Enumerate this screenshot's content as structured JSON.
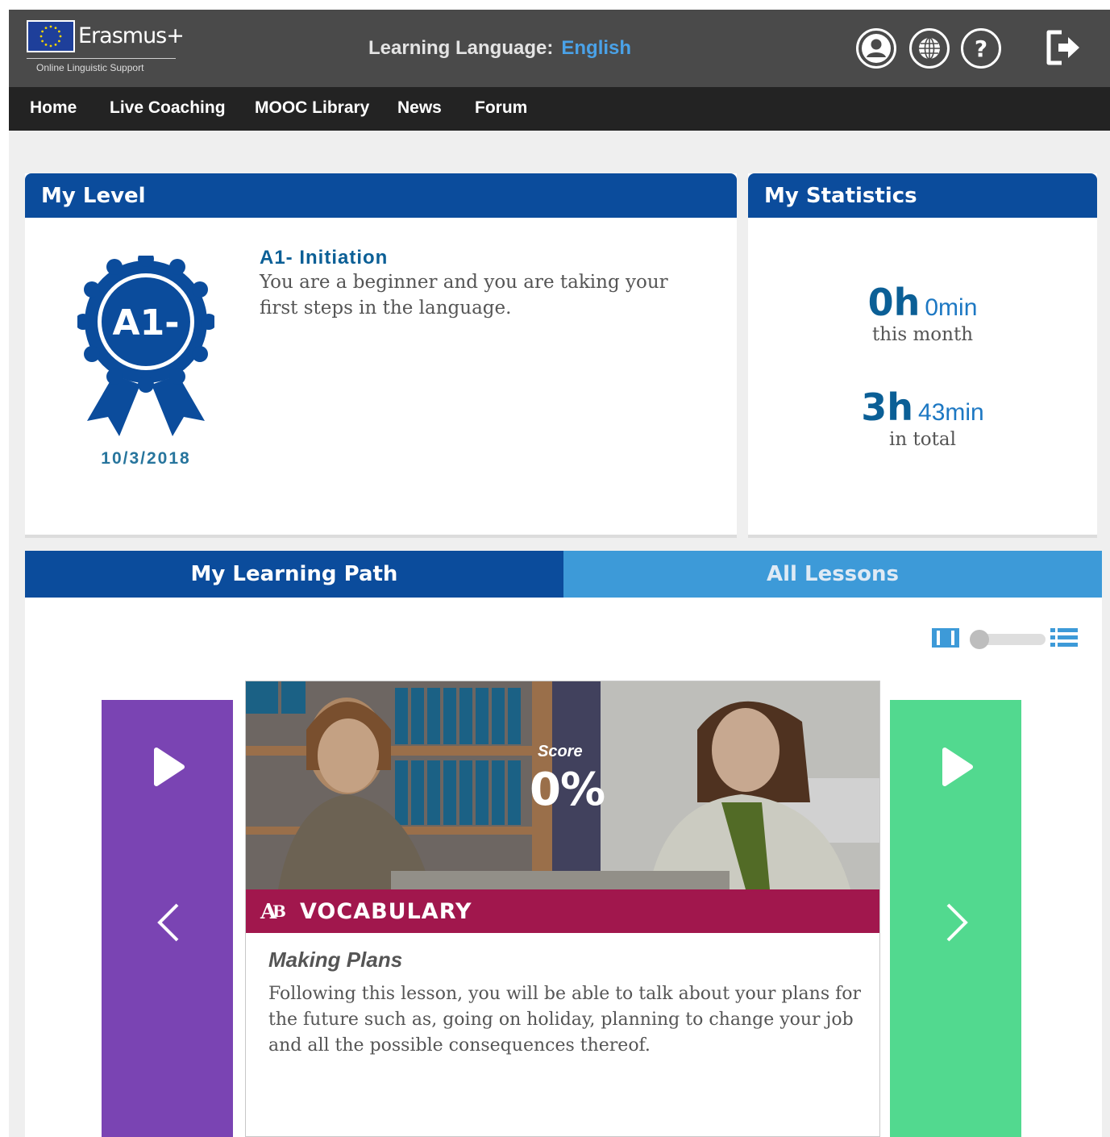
{
  "brand": {
    "name": "Erasmus+",
    "subtitle": "Online Linguistic Support"
  },
  "header": {
    "learning_language_label": "Learning Language:",
    "learning_language_value": "English",
    "icons": [
      "user-icon",
      "globe-icon",
      "help-icon",
      "logout-icon"
    ]
  },
  "nav": {
    "items": [
      {
        "label": "Home"
      },
      {
        "label": "Live Coaching"
      },
      {
        "label": "MOOC Library"
      },
      {
        "label": "News"
      },
      {
        "label": "Forum"
      }
    ]
  },
  "my_level": {
    "title": "My Level",
    "badge": "A1-",
    "date": "10/3/2018",
    "level_name": "A1- Initiation",
    "description": "You are a beginner and you are taking your first steps in the language."
  },
  "my_statistics": {
    "title": "My Statistics",
    "month": {
      "hours": "0h",
      "minutes": "0min",
      "label": "this month"
    },
    "total": {
      "hours": "3h",
      "minutes": "43min",
      "label": "in total"
    }
  },
  "tabs": [
    {
      "label": "My Learning Path",
      "active": true
    },
    {
      "label": "All Lessons",
      "active": false
    }
  ],
  "view_toggle": {
    "icons": [
      "grid-view-icon",
      "list-view-icon"
    ],
    "state": "grid"
  },
  "lesson": {
    "score_label": "Score",
    "score_value": "0%",
    "type": "VOCABULARY",
    "title": "Making Plans",
    "description": "Following this lesson, you will be able to talk about your plans for the future such as, going on holiday, planning to change your job and all the possible consequences thereof."
  },
  "colors": {
    "header_bg": "#4a4a4a",
    "nav_bg": "#232323",
    "primary_blue": "#0b4c9c",
    "light_blue": "#3d9ad8",
    "purple": "#7a44b3",
    "green": "#52d98f",
    "vocabulary": "#a1174d"
  }
}
